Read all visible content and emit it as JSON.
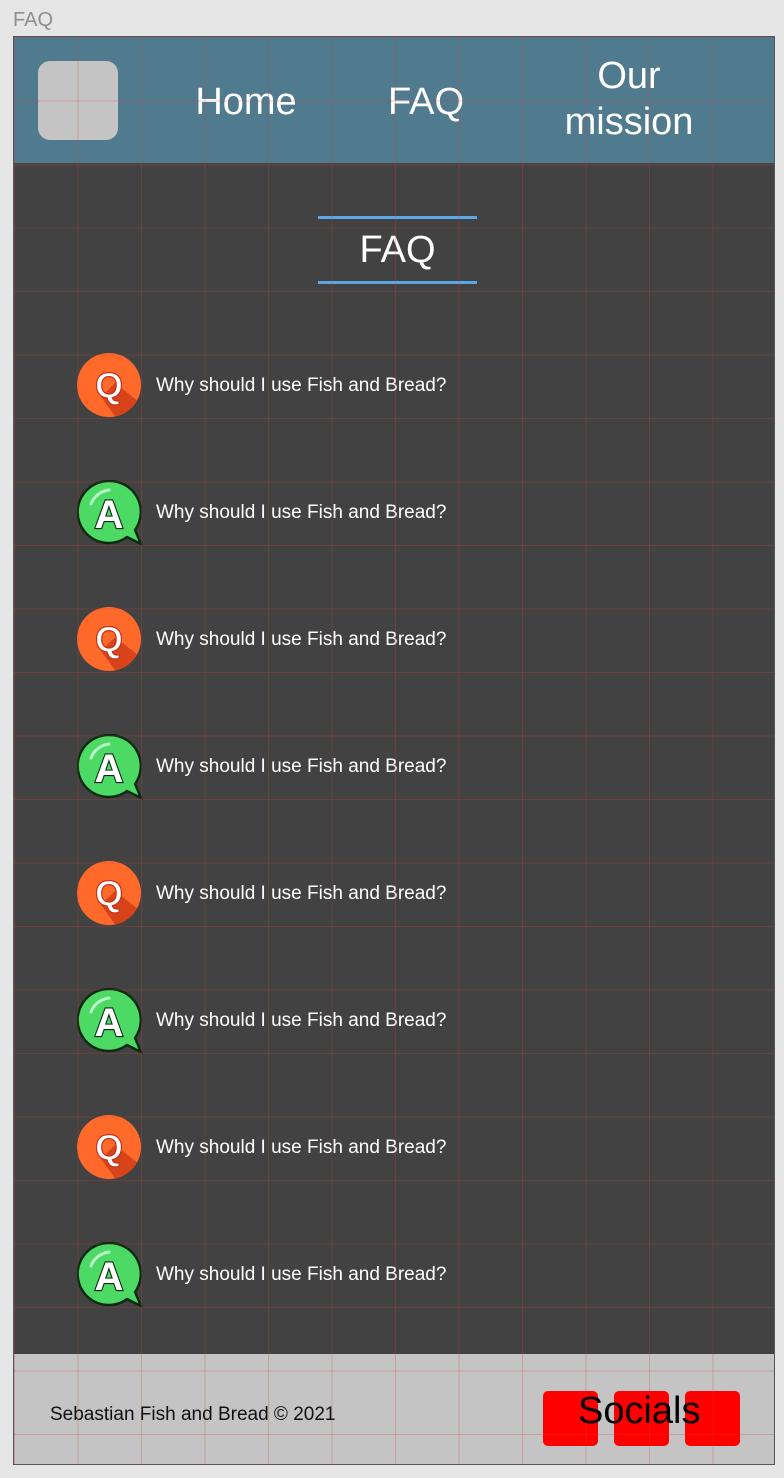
{
  "frame": {
    "label": "FAQ"
  },
  "nav": {
    "home": "Home",
    "faq": "FAQ",
    "mission_line1": "Our",
    "mission_line2": "mission"
  },
  "page": {
    "title": "FAQ"
  },
  "faq": {
    "items": [
      {
        "type": "Q",
        "icon": "question-icon",
        "text": "Why should I use Fish and Bread?"
      },
      {
        "type": "A",
        "icon": "answer-icon",
        "text": "Why should I use Fish and Bread?"
      },
      {
        "type": "Q",
        "icon": "question-icon",
        "text": "Why should I use Fish and Bread?"
      },
      {
        "type": "A",
        "icon": "answer-icon",
        "text": "Why should I use Fish and Bread?"
      },
      {
        "type": "Q",
        "icon": "question-icon",
        "text": "Why should I use Fish and Bread?"
      },
      {
        "type": "A",
        "icon": "answer-icon",
        "text": "Why should I use Fish and Bread?"
      },
      {
        "type": "Q",
        "icon": "question-icon",
        "text": "Why should I use Fish and Bread?"
      },
      {
        "type": "A",
        "icon": "answer-icon",
        "text": "Why should I use Fish and Bread?"
      }
    ]
  },
  "footer": {
    "copyright": "Sebastian Fish and Bread © 2021",
    "socials_label": "Socials"
  },
  "colors": {
    "nav_bg": "#507b8e",
    "body_bg": "#424242",
    "accent_line": "#5aa9e6",
    "footer_bg": "#c4c4c4",
    "social_button": "#ff0000",
    "question_badge": "#ff6a2b",
    "answer_badge": "#4cd964"
  }
}
